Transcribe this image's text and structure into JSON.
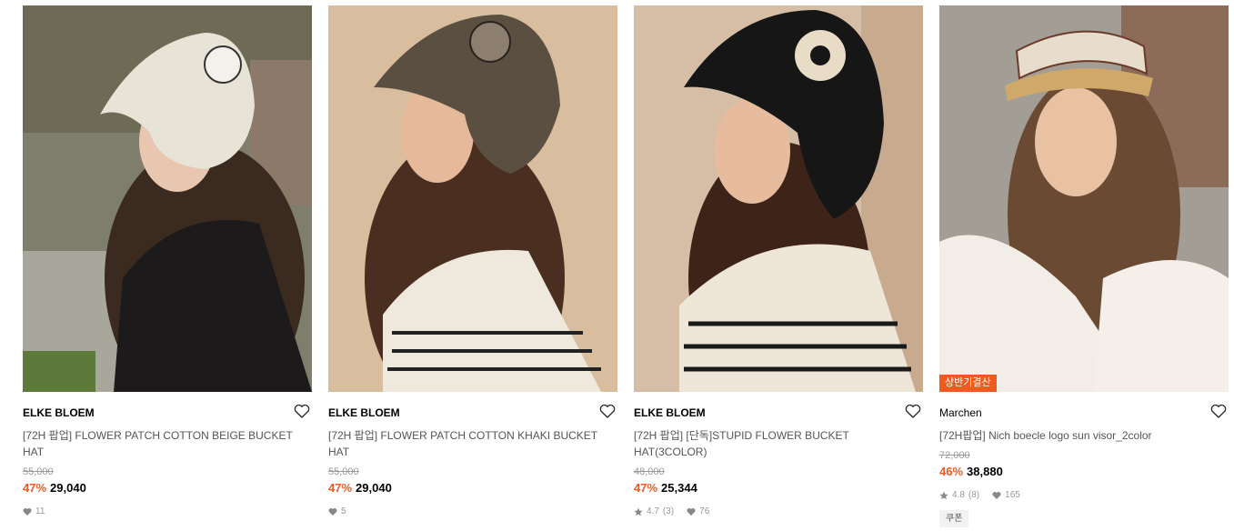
{
  "products": [
    {
      "brand": "ELKE BLOEM",
      "title": "[72H 팝업] FLOWER PATCH COTTON BEIGE BUCKET HAT",
      "original_price": "55,000",
      "discount": "47%",
      "price": "29,040",
      "likes": "11",
      "image_icon": "beige-bucket-hat-photo",
      "bg": "#8a8878",
      "hat": "#e7e3d6"
    },
    {
      "brand": "ELKE BLOEM",
      "title": "[72H 팝업] FLOWER PATCH COTTON KHAKI BUCKET HAT",
      "original_price": "55,000",
      "discount": "47%",
      "price": "29,040",
      "likes": "5",
      "image_icon": "khaki-bucket-hat-photo",
      "bg": "#d8bc9e",
      "hat": "#5b4f42"
    },
    {
      "brand": "ELKE BLOEM",
      "title": "[72H 팝업] [단독]STUPID FLOWER BUCKET HAT(3COLOR)",
      "original_price": "48,000",
      "discount": "47%",
      "price": "25,344",
      "rating": "4.7",
      "reviews": "(3)",
      "likes": "76",
      "image_icon": "black-knit-flower-bucket-hat-photo",
      "bg": "#d6bfa6",
      "hat": "#161616"
    },
    {
      "brand": "Marchen",
      "title": "[72H팝업] Nich boecle logo sun visor_2color",
      "original_price": "72,000",
      "discount": "46%",
      "price": "38,880",
      "rating": "4.8",
      "reviews": "(8)",
      "likes": "165",
      "badge": "상반기결산",
      "coupon": "쿠폰",
      "image_icon": "straw-sun-visor-photo",
      "bg": "#a8a49c",
      "hat": "#cfa86a"
    }
  ],
  "colors": {
    "accent": "#f05a1e",
    "muted": "#9b9b9b"
  }
}
